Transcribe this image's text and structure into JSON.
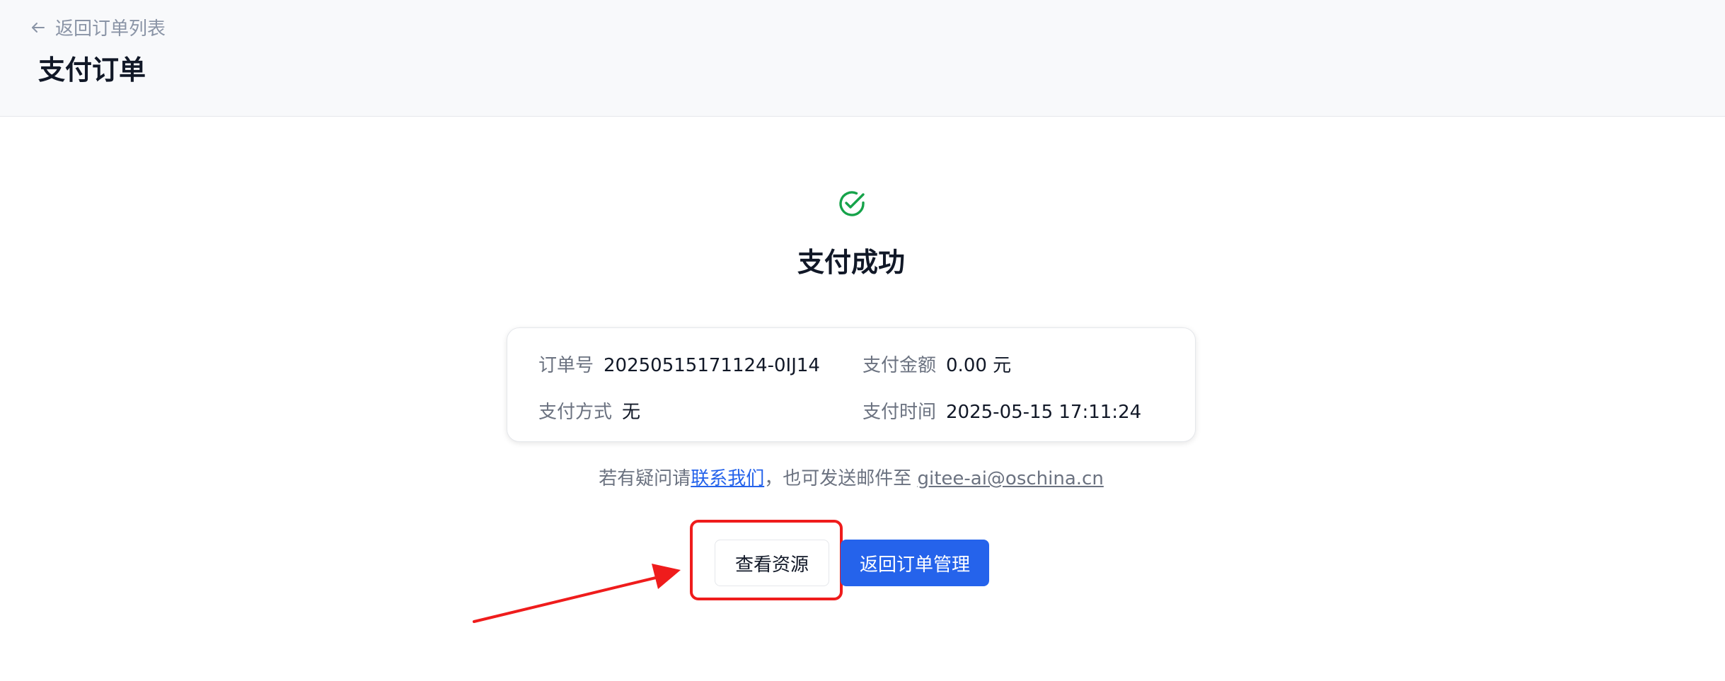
{
  "header": {
    "back_link": "返回订单列表",
    "title": "支付订单"
  },
  "result": {
    "title": "支付成功",
    "icon": "check-circle-icon"
  },
  "order_info": {
    "order_no_label": "订单号",
    "order_no_value": "20250515171124-0IJ14",
    "amount_label": "支付金额",
    "amount_value": "0.00 元",
    "method_label": "支付方式",
    "method_value": "无",
    "time_label": "支付时间",
    "time_value": "2025-05-15 17:11:24"
  },
  "help": {
    "prefix": "若有疑问请",
    "contact_link": "联系我们",
    "middle": "，也可发送邮件至 ",
    "email": "gitee-ai@oschina.cn"
  },
  "actions": {
    "view_resources": "查看资源",
    "back_to_orders": "返回订单管理"
  },
  "colors": {
    "primary": "#2563eb",
    "success": "#16a34a",
    "annotation": "#ef1c1c"
  }
}
